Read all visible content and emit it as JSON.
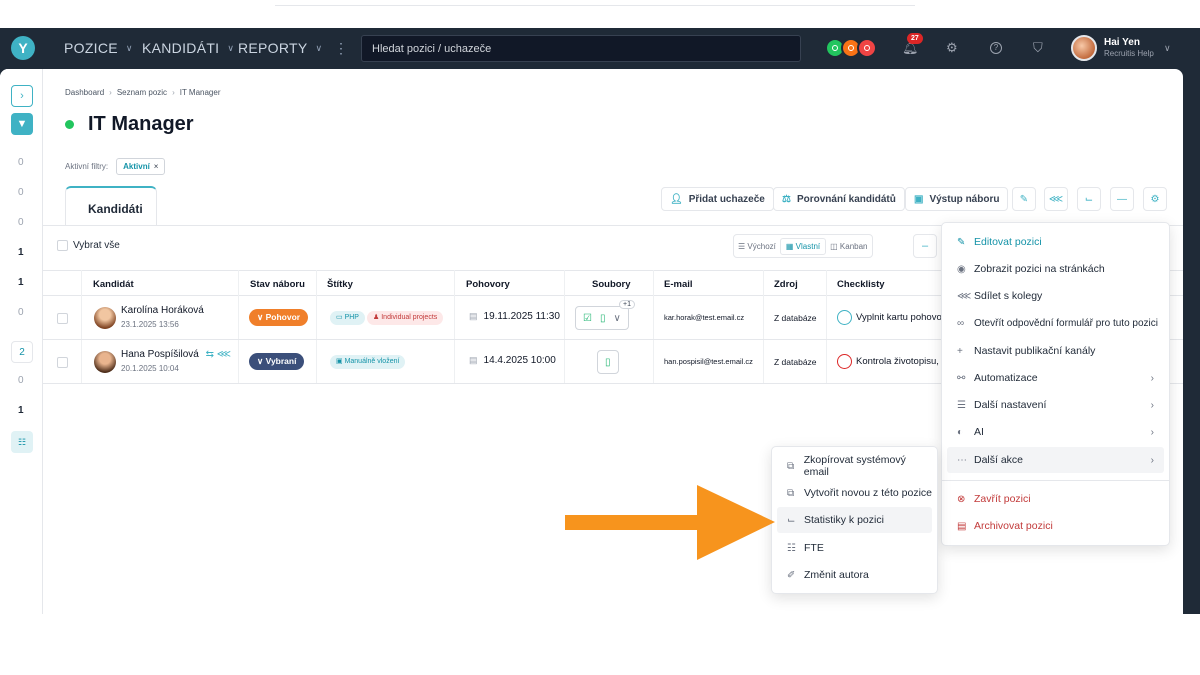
{
  "nav": {
    "logo": "Y",
    "menus": [
      "POZICE",
      "KANDIDÁTI",
      "REPORTY"
    ],
    "more": "⋮",
    "search_placeholder": "Hledat pozici / uchazeče",
    "status_colors": [
      "#22c55e",
      "#f97316",
      "#ef4444"
    ],
    "notifications_count": "27",
    "user_name": "Hai Yen",
    "user_role": "Recruitis Help"
  },
  "sidebar": {
    "counts": [
      "0",
      "0",
      "0",
      "1",
      "1",
      "0",
      "2",
      "0",
      "1"
    ]
  },
  "breadcrumb": [
    "Dashboard",
    "Seznam pozic",
    "IT Manager"
  ],
  "page_title": "IT Manager",
  "filters": {
    "label": "Aktivní filtry:",
    "chip": "Aktivní"
  },
  "tab": "Kandidáti",
  "toolbar": {
    "add_candidate": "Přidat uchazeče",
    "compare": "Porovnání kandidátů",
    "output": "Výstup náboru"
  },
  "list": {
    "select_all": "Vybrat vše",
    "views": [
      "Výchozí",
      "Vlastní",
      "Kanban"
    ]
  },
  "table": {
    "headers": [
      "Kandidát",
      "Stav náboru",
      "Štítky",
      "Pohovory",
      "Soubory",
      "E-mail",
      "Zdroj",
      "Checklisty"
    ],
    "rows": [
      {
        "name": "Karolína Horáková",
        "date": "23.1.2025 13:56",
        "stav": "Pohovor",
        "stav_color": "#f07f2a",
        "tags": [
          "PHP",
          "Individual projects"
        ],
        "interview": "19.11.2025 11:30",
        "files_extra": "+1",
        "email": "kar.horak@test.email.cz",
        "zdroj": "Z databáze",
        "checklist": "Vyplnit kartu pohovor",
        "ring_color": "#3fb2c4"
      },
      {
        "name": "Hana Pospíšilová",
        "date": "20.1.2025 10:04",
        "stav": "Vybraní",
        "stav_color": "#3b4f7a",
        "tags": [
          "Manuálně vložení"
        ],
        "interview": "14.4.2025 10:00",
        "email": "han.pospisil@test.email.cz",
        "zdroj": "Z databáze",
        "checklist": "Kontrola životopisu, p",
        "ring_color": "#dc2626"
      }
    ]
  },
  "main_menu": {
    "items": [
      "Editovat pozici",
      "Zobrazit pozici na stránkách",
      "Sdílet s kolegy",
      "Otevřít odpovědní formulář pro tuto pozici",
      "Nastavit publikační kanály",
      "Automatizace",
      "Další nastavení",
      "AI",
      "Další akce",
      "Zavřít pozici",
      "Archivovat pozici"
    ]
  },
  "sub_menu": {
    "items": [
      "Zkopírovat systémový email",
      "Vytvořit novou z této pozice",
      "Statistiky k pozici",
      "FTE",
      "Změnit autora"
    ]
  },
  "arrow_color": "#f7941d"
}
